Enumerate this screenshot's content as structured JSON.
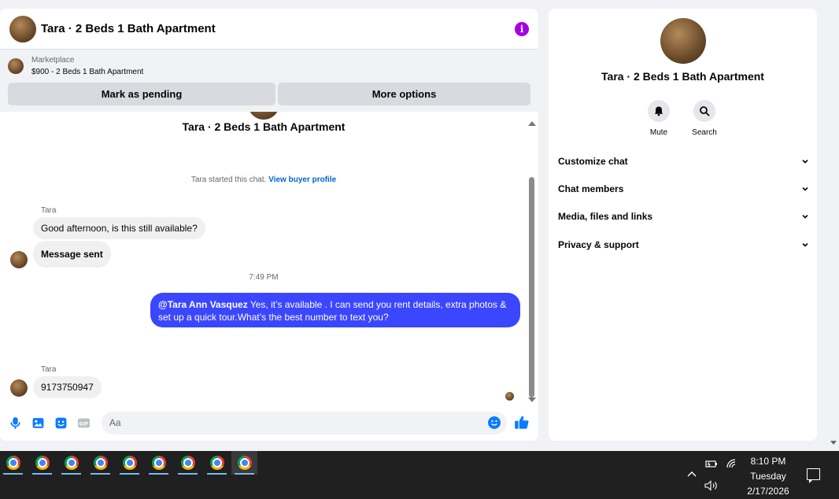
{
  "chat": {
    "header_title": "Tara · 2 Beds 1 Bath Apartment",
    "marketplace_label": "Marketplace",
    "listing": "$900 - 2 Beds 1 Bath Apartment",
    "mark_pending": "Mark as pending",
    "more_options": "More options"
  },
  "thread": {
    "title": "Tara · 2 Beds 1 Bath Apartment",
    "started_text": "Tara started this chat.",
    "view_profile": "View buyer profile",
    "messages": [
      {
        "sender": "Tara",
        "text": "Good afternoon, is this still available?"
      },
      {
        "text": "Message sent"
      },
      {
        "timestamp": "7:49 PM"
      },
      {
        "mention": "@Tara Ann Vasquez",
        "text": " Yes, it’s available .  I can send you rent details, extra photos & set up a quick tour.What’s the best number to text you?"
      },
      {
        "sender": "Tara",
        "text": "9173750947"
      }
    ]
  },
  "composer": {
    "placeholder": "Aa",
    "icons": [
      "microphone-icon",
      "image-icon",
      "sticker-icon",
      "gif-icon",
      "emoji-icon",
      "thumbs-up-icon"
    ]
  },
  "info_panel": {
    "title": "Tara · 2 Beds 1 Bath Apartment",
    "mute_label": "Mute",
    "search_label": "Search",
    "sections": [
      "Customize chat",
      "Chat members",
      "Media, files and links",
      "Privacy & support"
    ]
  },
  "taskbar": {
    "app_count": 9,
    "time": "8:10 PM",
    "day": "Tuesday",
    "date": "2/17/2026"
  },
  "colors": {
    "accent": "#0064d1",
    "outgoing_bubble": "#3b46ff",
    "info_icon": "#a400e8"
  }
}
